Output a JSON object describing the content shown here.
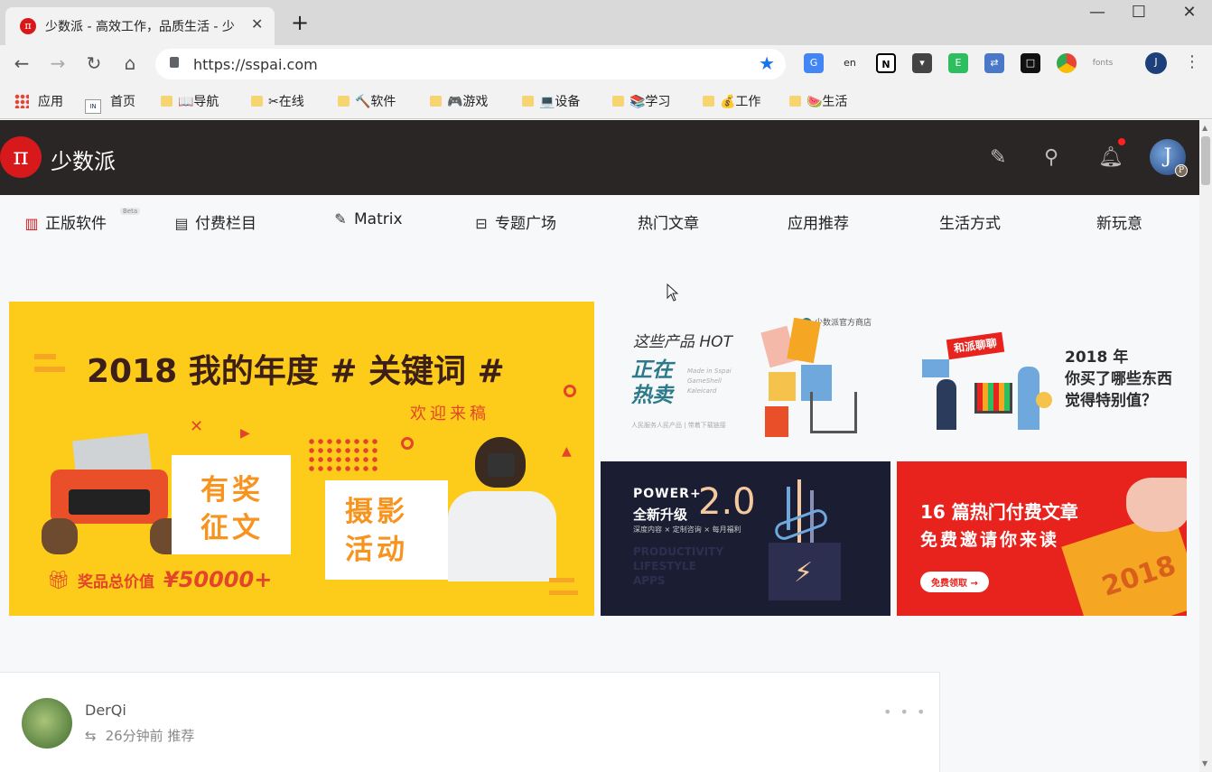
{
  "browser": {
    "tab_title": "少数派 - 高效工作，品质生活 - 少",
    "tab_favicon": "π",
    "new_tab": "+",
    "url": "https://sspai.com",
    "window_controls": [
      "—",
      "☐",
      "✕"
    ],
    "extensions": [
      "translate-icon",
      "en-icon",
      "notion-icon",
      "pocket-icon",
      "evernote-icon",
      "extension-icon",
      "square-icon",
      "chrome-icon",
      "fonts-icon"
    ],
    "fonts_ext_label": "fonts"
  },
  "bookmarks": [
    {
      "label": "应用",
      "type": "apps"
    },
    {
      "label": "首页",
      "type": "index"
    },
    {
      "label": "📖导航",
      "type": "folder"
    },
    {
      "label": "✂在线",
      "type": "folder"
    },
    {
      "label": "🔨软件",
      "type": "folder"
    },
    {
      "label": "🎮游戏",
      "type": "folder"
    },
    {
      "label": "💻设备",
      "type": "folder"
    },
    {
      "label": "📚学习",
      "type": "folder"
    },
    {
      "label": "💰工作",
      "type": "folder"
    },
    {
      "label": "🍉生活",
      "type": "folder"
    }
  ],
  "site": {
    "logo_symbol": "π",
    "name": "少数派",
    "avatar_letter": "J",
    "avatar_badge": "P"
  },
  "categories": [
    {
      "label": "正版软件",
      "icon": "store-icon",
      "badge": "Beta"
    },
    {
      "label": "付费栏目",
      "icon": "clipboard-icon"
    },
    {
      "label": "Matrix",
      "icon": "pen-icon"
    },
    {
      "label": "专题广场",
      "icon": "tray-icon"
    },
    {
      "label": "热门文章"
    },
    {
      "label": "应用推荐"
    },
    {
      "label": "生活方式"
    },
    {
      "label": "新玩意"
    }
  ],
  "banners": {
    "main": {
      "title": "2018 我的年度 # 关键词 #",
      "subtitle": "欢迎来稿",
      "card_a": "有奖\n征文",
      "card_b": "摄影\n活动",
      "prize_label": "奖品总价值",
      "prize_amount": "¥50000+"
    },
    "shop": {
      "line1": "这些产品 HOT",
      "brand": "少数派官方商店",
      "big": "正在\n热卖",
      "small": "Made in Sspai\nGameShell\nKaleicard",
      "foot": "人民服务人民产品 | 带着下载链接"
    },
    "year": {
      "sign": "和派聊聊",
      "text": "2018 年\n你买了哪些东西\n觉得特别值？"
    },
    "power": {
      "brand": "POWER+",
      "version": "2.0",
      "upgrade": "全新升级",
      "tags": "深度内容 × 定制咨询 × 每月福利",
      "ghost": "PRODUCTIVITY\nLIFESTYLE\nAPPS"
    },
    "paid": {
      "title": "16 篇热门付费文章",
      "subtitle": "免费邀请你来读",
      "button": "免费领取 →",
      "book_year": "2018"
    }
  },
  "feed": {
    "author": "DerQi",
    "meta": "26分钟前 推荐",
    "more": "• • •"
  },
  "colors": {
    "brand_red": "#d7191c",
    "header_dark": "#2a2626",
    "banner_yellow": "#fdcc1a",
    "banner_navy": "#1b1d33",
    "banner_red": "#e8231d"
  }
}
